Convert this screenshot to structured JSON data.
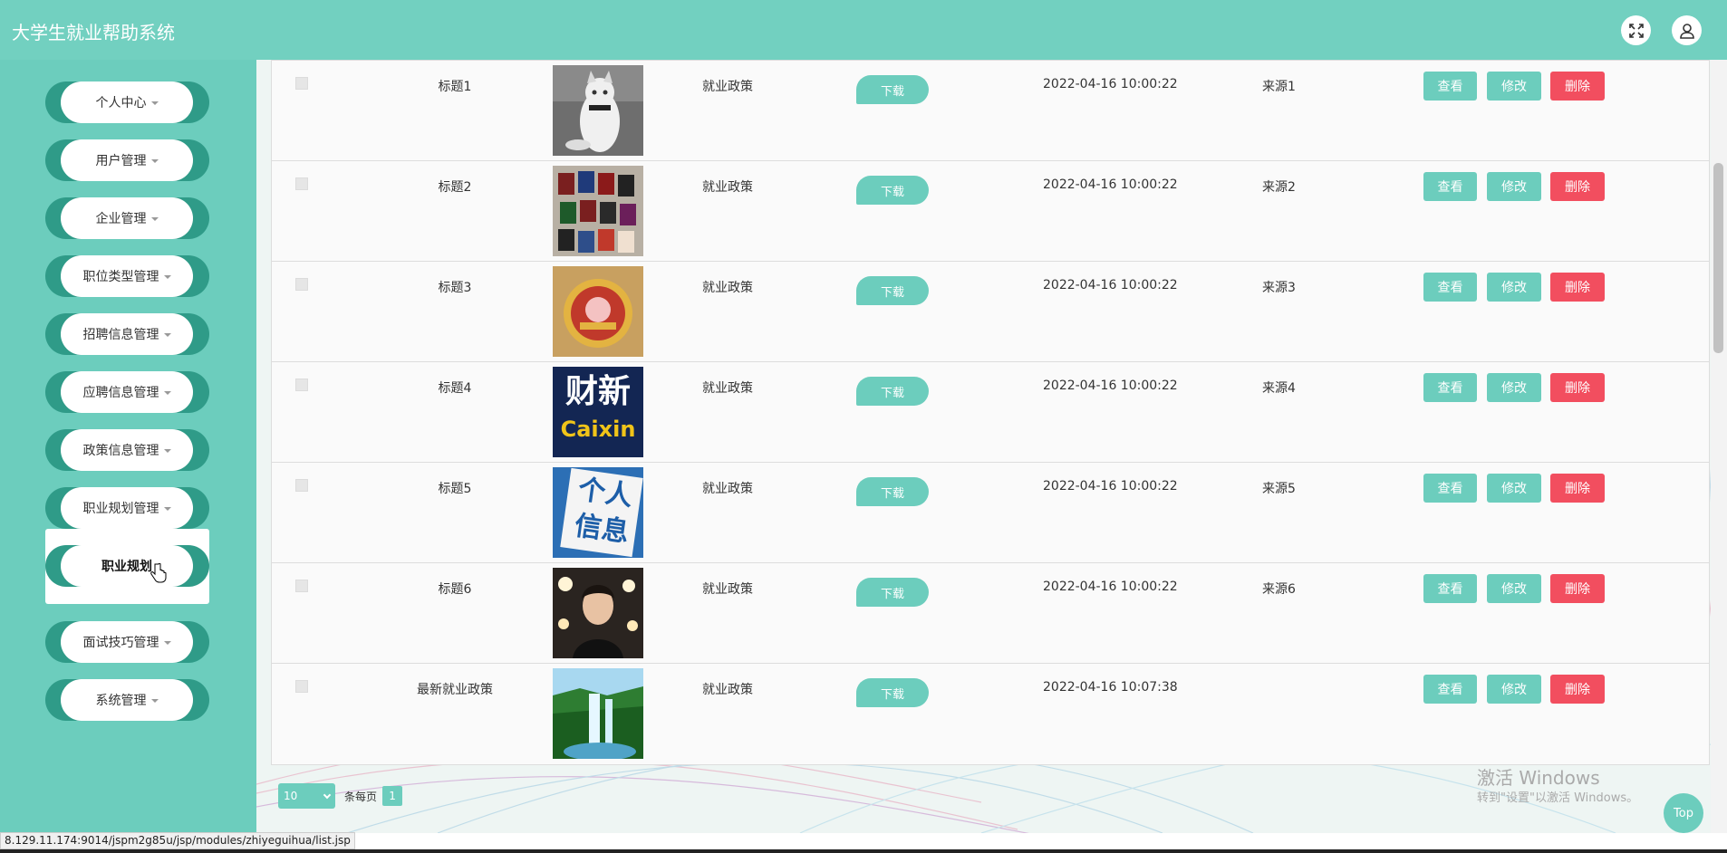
{
  "app": {
    "title": "大学生就业帮助系统"
  },
  "header_icons": [
    "fullscreen-icon",
    "user-icon"
  ],
  "sidebar": {
    "items": [
      {
        "label": "个人中心"
      },
      {
        "label": "用户管理"
      },
      {
        "label": "企业管理"
      },
      {
        "label": "职位类型管理"
      },
      {
        "label": "招聘信息管理"
      },
      {
        "label": "应聘信息管理"
      },
      {
        "label": "政策信息管理"
      },
      {
        "label": "职业规划管理"
      },
      {
        "label": "面试技巧管理"
      },
      {
        "label": "系统管理"
      }
    ],
    "submenu": {
      "label": "职业规划"
    }
  },
  "table": {
    "rows": [
      {
        "title": "标题1",
        "image": "cat",
        "type": "就业政策",
        "download": "下载",
        "time": "2022-04-16 10:00:22",
        "source": "来源1"
      },
      {
        "title": "标题2",
        "image": "passports",
        "type": "就业政策",
        "download": "下载",
        "time": "2022-04-16 10:00:22",
        "source": "来源2"
      },
      {
        "title": "标题3",
        "image": "emblem",
        "type": "就业政策",
        "download": "下载",
        "time": "2022-04-16 10:00:22",
        "source": "来源3"
      },
      {
        "title": "标题4",
        "image": "caixin-logo",
        "type": "就业政策",
        "download": "下载",
        "time": "2022-04-16 10:00:22",
        "source": "来源4",
        "image_text": [
          "财新",
          "Caixin"
        ]
      },
      {
        "title": "标题5",
        "image": "personal-info",
        "type": "就业政策",
        "download": "下载",
        "time": "2022-04-16 10:00:22",
        "source": "来源5",
        "image_text": [
          "个人",
          "信息"
        ]
      },
      {
        "title": "标题6",
        "image": "portrait",
        "type": "就业政策",
        "download": "下载",
        "time": "2022-04-16 10:00:22",
        "source": "来源6"
      },
      {
        "title": "最新就业政策",
        "image": "waterfall",
        "type": "就业政策",
        "download": "下载",
        "time": "2022-04-16 10:07:38",
        "source": ""
      }
    ],
    "actions": {
      "view": "查看",
      "edit": "修改",
      "delete": "删除"
    }
  },
  "pager": {
    "page_size": "10",
    "per_page_label": "条每页",
    "current_page": "1"
  },
  "watermark": {
    "line1": "激活 Windows",
    "line2": "转到\"设置\"以激活 Windows。"
  },
  "top_button": "Top",
  "status_url": "8.129.11.174:9014/jspm2g85u/jsp/modules/zhiyeguihua/list.jsp",
  "colors": {
    "primary": "#72d0c0",
    "sidebar": "#6ccdbd",
    "pill_dark": "#2f9b88",
    "delete": "#f24e5f"
  }
}
